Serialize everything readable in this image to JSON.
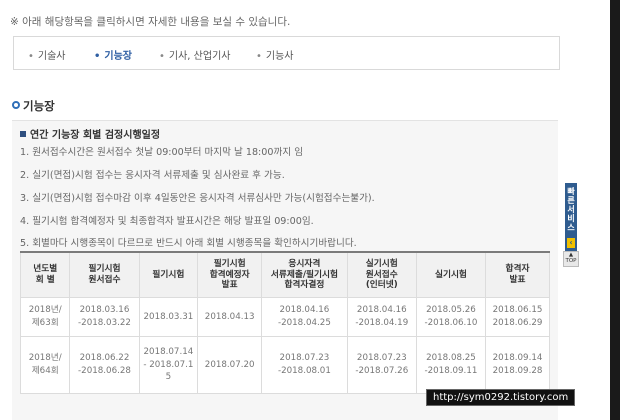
{
  "notice": "※ 아래 해당항목을 클릭하시면 자세한 내용을 보실 수 있습니다.",
  "tabs": [
    {
      "label": "기술사",
      "active": false
    },
    {
      "label": "기능장",
      "active": true
    },
    {
      "label": "기사, 산업기사",
      "active": false
    },
    {
      "label": "기능사",
      "active": false
    }
  ],
  "section_title": "기능장",
  "subheading": "연간 기능장 회별 검정시행일정",
  "notes": [
    "1. 원서접수시간은 원서접수 첫날 09:00부터 마지막 날 18:00까지 임",
    "2. 실기(면접)시험 접수는 응시자격 서류제출 및 심사완료 후 가능.",
    "3. 실기(면접)시험 접수마감 이후 4일동안은 응시자격 서류심사만 가능(시험접수는불가).",
    "4. 필기시험 합격예정자 및 최종합격자 발표시간은 해당 발표일 09:00임.",
    "5. 회별마다 시행종목이 다르므로 반드시 아래 회별 시행종목을 확인하시기바랍니다."
  ],
  "table": {
    "headers": [
      [
        "년도별",
        "회 별"
      ],
      [
        "필기시험",
        "원서접수"
      ],
      [
        "필기시험"
      ],
      [
        "필기시험",
        "합격예정자",
        "발표"
      ],
      [
        "응시자격",
        "서류제출/필기시험",
        "합격자결정"
      ],
      [
        "실기시험",
        "원서접수",
        "(인터넷)"
      ],
      [
        "실기시험"
      ],
      [
        "합격자",
        "발표"
      ]
    ],
    "rows": [
      [
        [
          "2018년/",
          "제63회"
        ],
        [
          "2018.03.16",
          "-2018.03.22"
        ],
        [
          "2018.03.31"
        ],
        [
          "2018.04.13"
        ],
        [
          "2018.04.16",
          "-2018.04.25"
        ],
        [
          "2018.04.16",
          "-2018.04.19"
        ],
        [
          "2018.05.26",
          "-2018.06.10"
        ],
        [
          "2018.06.15",
          "2018.06.29"
        ]
      ],
      [
        [
          "2018년/",
          "제64회"
        ],
        [
          "2018.06.22",
          "-2018.06.28"
        ],
        [
          "2018.07.14",
          "- 2018.07.1",
          "5"
        ],
        [
          "2018.07.20"
        ],
        [
          "2018.07.23",
          "-2018.08.01"
        ],
        [
          "2018.07.23",
          "-2018.07.26"
        ],
        [
          "2018.08.25",
          "-2018.09.11"
        ],
        [
          "2018.09.14",
          "2018.09.28"
        ]
      ]
    ]
  },
  "side_widget": {
    "label_chars": [
      "빠",
      "른",
      "서",
      "비",
      "스"
    ],
    "arrow": "‹",
    "top_label": "TOP"
  },
  "watermark": "http://sym0292.tistory.com"
}
